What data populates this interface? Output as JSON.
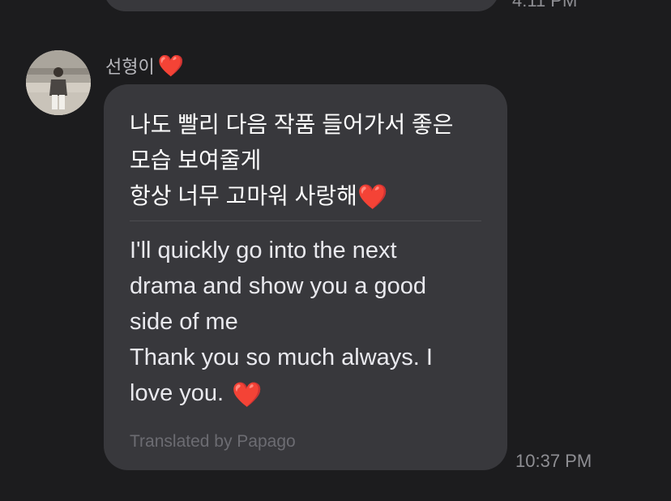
{
  "previous_message": {
    "timestamp": "4:11 PM"
  },
  "message": {
    "sender": "선형이",
    "sender_emoji": "❤️",
    "original_lines": [
      "나도 빨리 다음 작품 들어가서 좋은",
      "모습 보여줄게",
      "항상 너무 고마워 사랑해"
    ],
    "original_emoji": "❤️",
    "translated_lines": [
      "I'll quickly go into the next",
      "drama and show you a good",
      "side of me",
      "Thank you so much always. I",
      "love you."
    ],
    "translated_emoji": "❤️",
    "translation_credit": "Translated by Papago",
    "timestamp": "10:37 PM"
  }
}
